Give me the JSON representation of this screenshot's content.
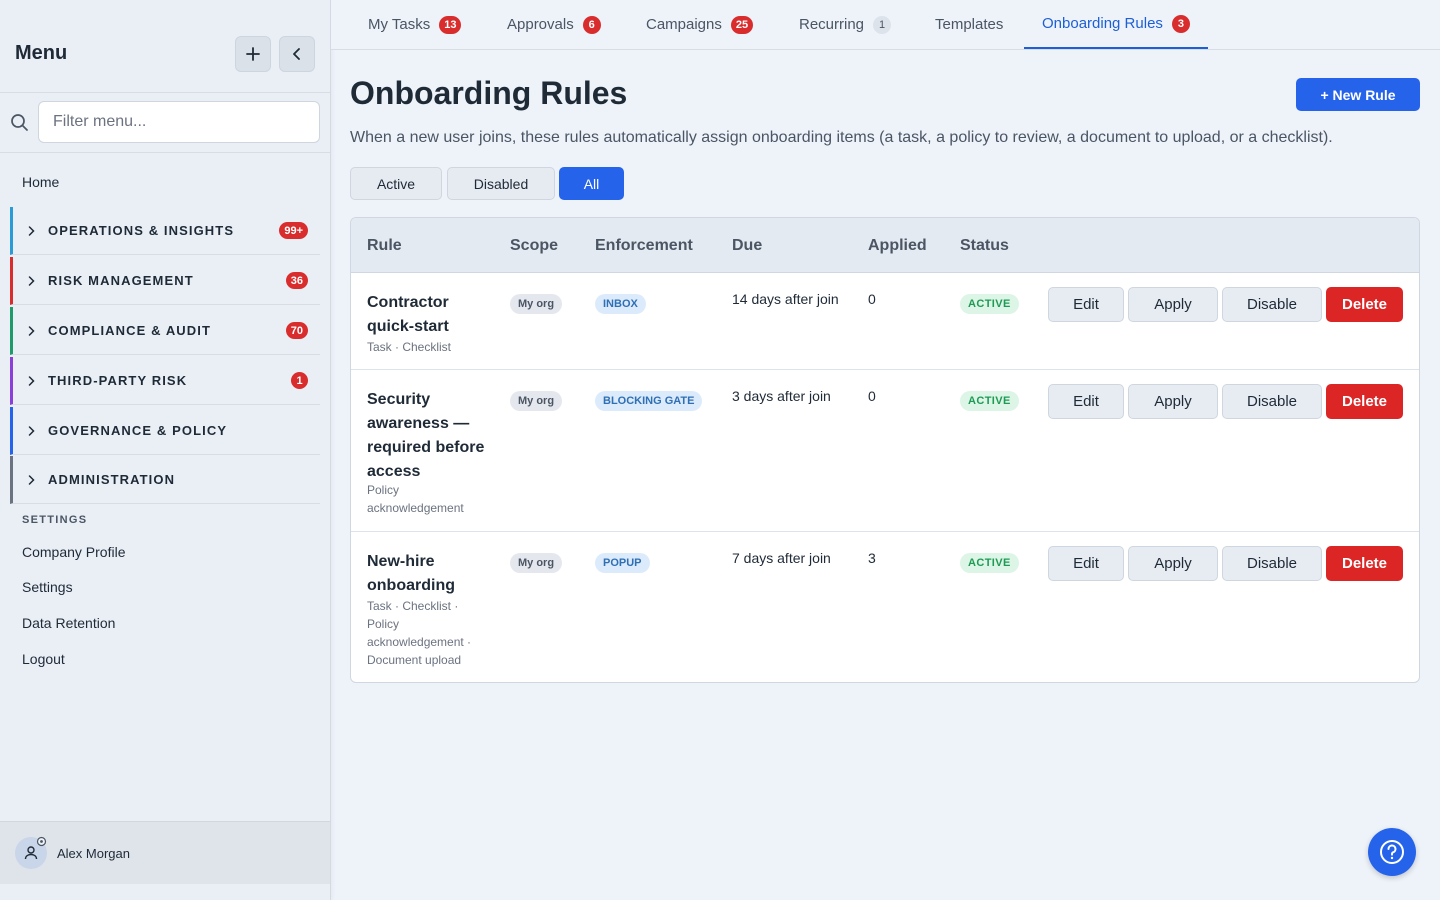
{
  "sidebar": {
    "title": "Menu",
    "filter_placeholder": "Filter menu...",
    "home": "Home",
    "groups": [
      {
        "label": "OPERATIONS & INSIGHTS",
        "badge": "99+",
        "color": "#2b9bd6"
      },
      {
        "label": "RISK MANAGEMENT",
        "badge": "36",
        "color": "#d92d2d"
      },
      {
        "label": "COMPLIANCE & AUDIT",
        "badge": "70",
        "color": "#1f9a6b"
      },
      {
        "label": "THIRD-PARTY RISK",
        "badge": "1",
        "color": "#8b3fd9"
      },
      {
        "label": "GOVERNANCE & POLICY",
        "badge": "",
        "color": "#2563eb"
      },
      {
        "label": "ADMINISTRATION",
        "badge": "",
        "color": "#6b7280"
      }
    ],
    "settings_heading": "SETTINGS",
    "settings_links": [
      "Company Profile",
      "Settings",
      "Data Retention",
      "Logout"
    ],
    "user": "Alex Morgan"
  },
  "tabs": [
    {
      "label": "My Tasks",
      "badge": "13"
    },
    {
      "label": "Approvals",
      "badge": "6"
    },
    {
      "label": "Campaigns",
      "badge": "25"
    },
    {
      "label": "Recurring",
      "badge": "1"
    },
    {
      "label": "Templates",
      "badge": ""
    },
    {
      "label": "Onboarding Rules",
      "badge": "3"
    }
  ],
  "page": {
    "title": "Onboarding Rules",
    "new_rule": "+ New Rule",
    "description": "When a new user joins, these rules automatically assign onboarding items (a task, a policy to review, a document to upload, or a checklist).",
    "filters": [
      "Active",
      "Disabled",
      "All"
    ],
    "active_filter": "All"
  },
  "table": {
    "headers": [
      "Rule",
      "Scope",
      "Enforcement",
      "Due",
      "Applied",
      "Status"
    ],
    "rows": [
      {
        "name": "Contractor quick-start",
        "items": "Task · Checklist",
        "scope": "My org",
        "enforcement": "INBOX",
        "due": "14 days after join",
        "applied": "0",
        "status": "ACTIVE"
      },
      {
        "name": "Security awareness — required before access",
        "items": "Policy acknowledgement",
        "scope": "My org",
        "enforcement": "BLOCKING GATE",
        "due": "3 days after join",
        "applied": "0",
        "status": "ACTIVE"
      },
      {
        "name": "New-hire onboarding",
        "items": "Task · Checklist · Policy acknowledgement · Document upload",
        "scope": "My org",
        "enforcement": "POPUP",
        "due": "7 days after join",
        "applied": "3",
        "status": "ACTIVE"
      }
    ],
    "actions": {
      "edit": "Edit",
      "apply": "Apply",
      "disable": "Disable",
      "delete": "Delete"
    }
  },
  "colors": {
    "accent": "#2563eb",
    "danger": "#dc2626",
    "badge": "#d92d2d"
  }
}
